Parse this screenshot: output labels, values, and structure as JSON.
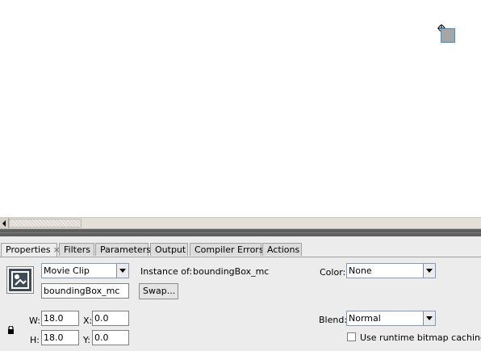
{
  "tabs": [
    {
      "label": "Properties",
      "close": "×"
    },
    {
      "label": "Filters"
    },
    {
      "label": "Parameters"
    },
    {
      "label": "Output"
    },
    {
      "label": "Compiler Errors"
    },
    {
      "label": "Actions"
    }
  ],
  "properties": {
    "symbol_type": "Movie Clip",
    "instance_name": "boundingBox_mc",
    "instance_of_label": "Instance of:",
    "instance_of_value": "boundingBox_mc",
    "swap_button": "Swap...",
    "color_label": "Color:",
    "color_value": "None",
    "blend_label": "Blend:",
    "blend_value": "Normal",
    "cache_label": "Use runtime bitmap caching",
    "cache_checked": false,
    "w_label": "W:",
    "w_value": "18.0",
    "h_label": "H:",
    "h_value": "18.0",
    "x_label": "X:",
    "x_value": "0.0",
    "y_label": "Y:",
    "y_value": "0.0"
  },
  "icons": {
    "registration": "crosshair-icon",
    "symbol": "movie-clip-icon",
    "lock": "lock-icon"
  },
  "colors": {
    "selection_outline": "#3b8fd6",
    "clip_fill": "#a6a6a6",
    "panel_bg": "#ececec"
  }
}
